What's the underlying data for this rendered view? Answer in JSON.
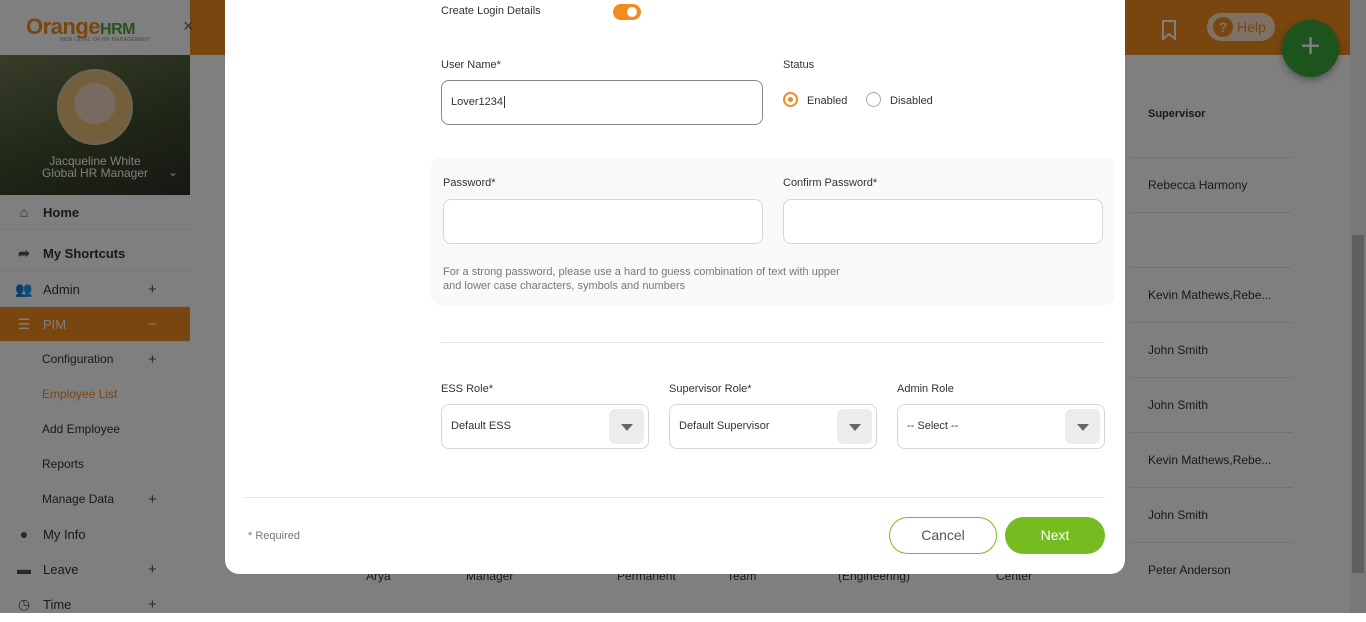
{
  "brand": {
    "name_orange": "Orange",
    "name_hrm": "HRM",
    "tagline": "NEW LEVEL OF HR MANAGEMENT"
  },
  "header": {
    "help_label": "Help"
  },
  "profile": {
    "name": "Jacqueline White",
    "role": "Global HR Manager"
  },
  "sidebar": {
    "items": [
      {
        "label": "Home",
        "icon": "home-icon"
      },
      {
        "label": "My Shortcuts",
        "icon": "share-icon"
      },
      {
        "label": "Admin",
        "icon": "admin-icon"
      },
      {
        "label": "PIM",
        "icon": "pim-icon"
      },
      {
        "label": "My Info",
        "icon": "user-icon"
      },
      {
        "label": "Leave",
        "icon": "briefcase-icon"
      },
      {
        "label": "Time",
        "icon": "clock-icon"
      }
    ],
    "pim_subitems": [
      {
        "label": "Configuration"
      },
      {
        "label": "Employee List"
      },
      {
        "label": "Add Employee"
      },
      {
        "label": "Reports"
      },
      {
        "label": "Manage Data"
      }
    ]
  },
  "table": {
    "supervisor_header": "Supervisor",
    "supervisors": [
      "Rebecca Harmony",
      "Kevin Mathews,Rebe...",
      "John Smith",
      "John Smith",
      "Kevin Mathews,Rebe...",
      "John Smith",
      "Peter Anderson"
    ],
    "bottom_row": [
      "Arya",
      "Manager",
      "Permanent",
      "Team",
      "(Engineering)",
      "Center"
    ]
  },
  "form": {
    "create_login_label": "Create Login Details",
    "create_login_on": true,
    "username_label": "User Name*",
    "username_value": "Lover1234",
    "status_label": "Status",
    "status_enabled": "Enabled",
    "status_disabled": "Disabled",
    "status_selected": "Enabled",
    "password_label": "Password*",
    "confirm_password_label": "Confirm Password*",
    "password_hint_line1": "For a strong password, please use a hard to guess combination of text with upper",
    "password_hint_line2": "and lower case characters, symbols and numbers",
    "ess_role_label": "ESS Role*",
    "ess_role_value": "Default ESS",
    "supervisor_role_label": "Supervisor Role*",
    "supervisor_role_value": "Default Supervisor",
    "admin_role_label": "Admin Role",
    "admin_role_value": "-- Select --",
    "required_note": "* Required",
    "cancel_label": "Cancel",
    "next_label": "Next"
  },
  "colors": {
    "accent": "#f28c1e",
    "primary_button": "#76bc21",
    "fab": "#3aa63a"
  }
}
